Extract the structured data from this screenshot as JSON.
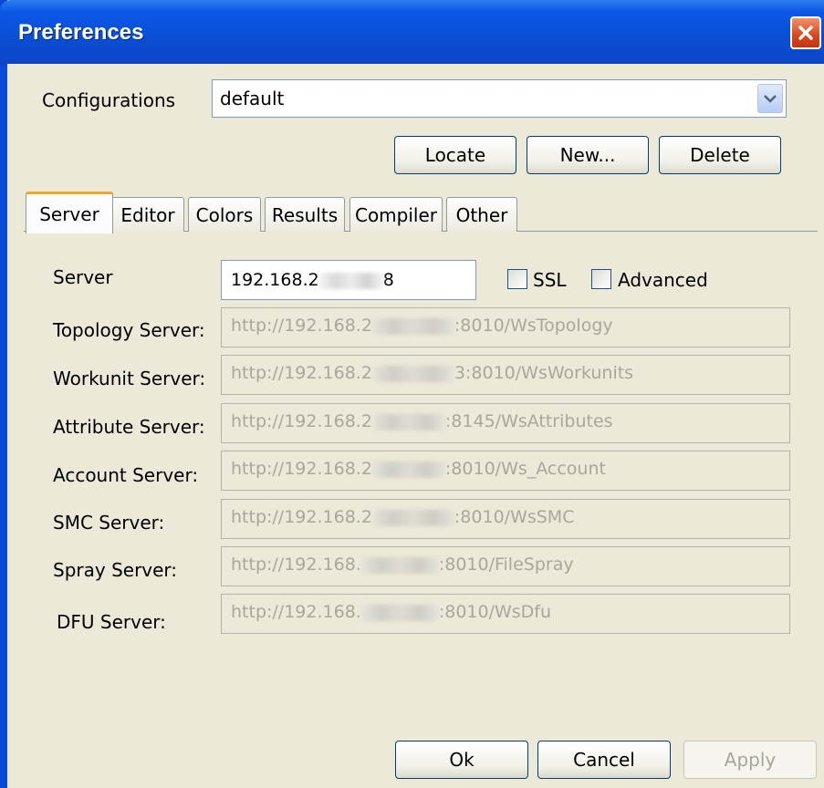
{
  "window": {
    "title": "Preferences"
  },
  "config": {
    "label": "Configurations",
    "selected": "default"
  },
  "buttons": {
    "locate": "Locate",
    "new": "New...",
    "delete": "Delete",
    "ok": "Ok",
    "cancel": "Cancel",
    "apply": "Apply"
  },
  "tabs": [
    "Server",
    "Editor",
    "Colors",
    "Results",
    "Compiler",
    "Other"
  ],
  "server": {
    "label": "Server",
    "ip_prefix": "192.168.2",
    "ip_suffix": "8",
    "ssl_label": "SSL",
    "advanced_label": "Advanced"
  },
  "fields": [
    {
      "label": "Topology Server:",
      "prefix": "http://192.168.2",
      "suffix": ":8010/WsTopology"
    },
    {
      "label": "Workunit Server:",
      "prefix": "http://192.168.2",
      "suffix": "3:8010/WsWorkunits"
    },
    {
      "label": "Attribute Server:",
      "prefix": "http://192.168.2",
      "suffix": ":8145/WsAttributes"
    },
    {
      "label": "Account Server:",
      "prefix": "http://192.168.2",
      "suffix": ":8010/Ws_Account"
    },
    {
      "label": "SMC Server:",
      "prefix": "http://192.168.2",
      "suffix": ":8010/WsSMC"
    },
    {
      "label": "Spray Server:",
      "prefix": "http://192.168.",
      "suffix": ":8010/FileSpray"
    },
    {
      "label": "DFU Server:",
      "prefix": "http://192.168.",
      "suffix": ":8010/WsDfu"
    }
  ],
  "icons": {
    "close": "close-icon",
    "dropdown": "chevron-down-icon"
  },
  "colors": {
    "titlebar": "#0a4fd8",
    "close": "#d9451d",
    "active_tab_accent": "#f5a623",
    "dialog_bg": "#ece9d8"
  }
}
